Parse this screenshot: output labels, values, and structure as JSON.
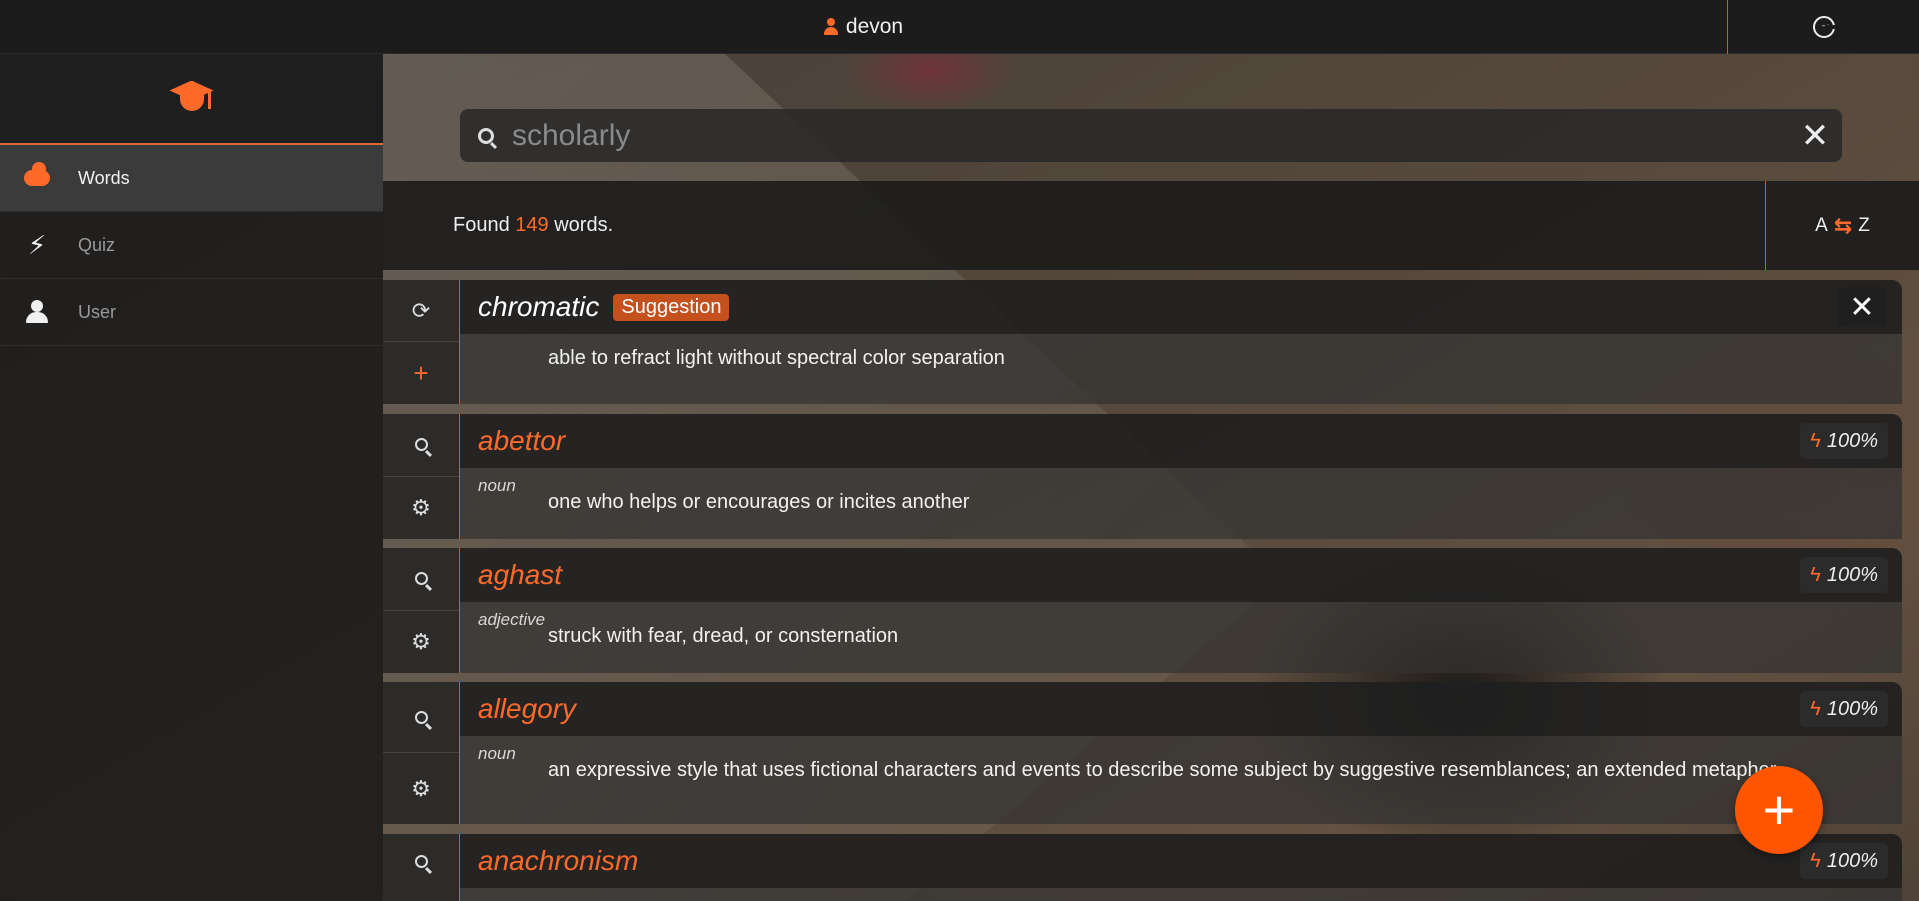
{
  "topbar": {
    "username": "devon",
    "user_icon": "user-icon",
    "logout_icon": "logout-icon"
  },
  "sidebar": {
    "logo_icon": "graduation-cap-icon",
    "items": [
      {
        "label": "Words",
        "icon": "cloud-icon",
        "active": true
      },
      {
        "label": "Quiz",
        "icon": "bolt-icon",
        "active": false
      },
      {
        "label": "User",
        "icon": "person-icon",
        "active": false
      }
    ]
  },
  "search": {
    "placeholder": "scholarly",
    "value": "",
    "clear_label": "✕"
  },
  "results": {
    "found_prefix": "Found",
    "count": "149",
    "found_suffix": "words.",
    "sort_left": "A",
    "sort_arrows": "⇆",
    "sort_right": "Z"
  },
  "suggestion": {
    "word": "chromatic",
    "badge": "Suggestion",
    "definition": "able to refract light without spectral color separation",
    "dismiss_label": "✕"
  },
  "words": [
    {
      "word": "abettor",
      "pos": "noun",
      "definition": "one who helps or encourages or incites another",
      "score": "100%"
    },
    {
      "word": "aghast",
      "pos": "adjective",
      "definition": "struck with fear, dread, or consternation",
      "score": "100%"
    },
    {
      "word": "allegory",
      "pos": "noun",
      "definition": "an expressive style that uses fictional characters and events to describe some subject by suggestive resemblances; an extended metaphor",
      "score": "100%"
    },
    {
      "word": "anachronism",
      "pos": "",
      "definition": "",
      "score": "100%"
    }
  ],
  "colors": {
    "accent": "#ff6a2b",
    "fab": "#ff5500",
    "badge": "#c4501e"
  },
  "fab_label": "+"
}
